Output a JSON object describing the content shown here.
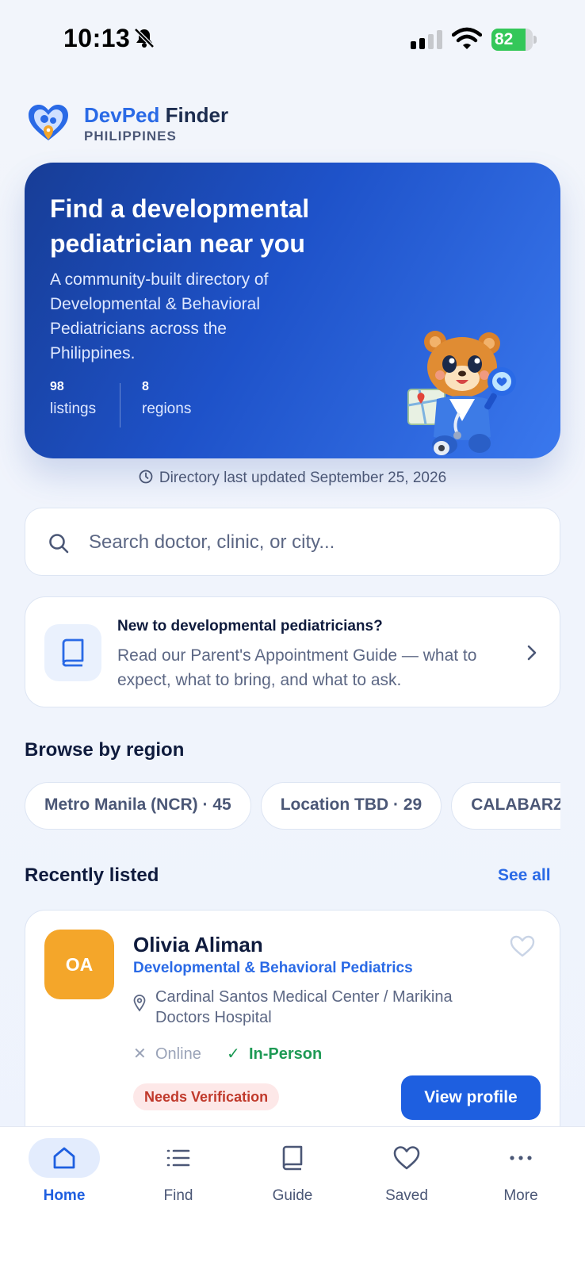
{
  "status_bar": {
    "time": "10:13",
    "battery": "82",
    "battery_level": 0.82
  },
  "brand": {
    "name_part1": "DevPed",
    "name_part2": "Finder",
    "country": "PHILIPPINES"
  },
  "hero": {
    "title": "Find a developmental pediatrician near you",
    "description": "A community-built directory of Developmental & Behavioral Pediatricians across the Philippines.",
    "stats": [
      {
        "value": "98",
        "label": "listings"
      },
      {
        "value": "8",
        "label": "regions"
      }
    ]
  },
  "updated_text": "Directory last updated September 25, 2026",
  "search": {
    "placeholder": "Search doctor, clinic, or city..."
  },
  "guide_card": {
    "title": "New to developmental pediatricians?",
    "text": "Read our Parent's Appointment Guide — what to expect, what to bring, and what to ask."
  },
  "regions": {
    "title": "Browse by region",
    "chips": [
      "Metro Manila (NCR) · 45",
      "Location TBD · 29",
      "CALABARZON"
    ]
  },
  "recent": {
    "title": "Recently listed",
    "see_all": "See all",
    "listing": {
      "initials": "OA",
      "name": "Olivia Aliman",
      "specialty": "Developmental & Behavioral Pediatrics",
      "location": "Cardinal Santos Medical Center / Marikina Doctors Hospital",
      "online_mark": "✕",
      "online_label": "Online",
      "inperson_mark": "✓",
      "inperson_label": "In-Person",
      "badge": "Needs Verification",
      "button": "View profile"
    }
  },
  "nav": {
    "items": [
      {
        "label": "Home",
        "icon": "home-icon"
      },
      {
        "label": "Find",
        "icon": "list-icon"
      },
      {
        "label": "Guide",
        "icon": "book-icon"
      },
      {
        "label": "Saved",
        "icon": "heart-icon"
      },
      {
        "label": "More",
        "icon": "more-icon"
      }
    ]
  },
  "colors": {
    "accent": "#2a6ae6",
    "button": "#1e5fe0",
    "avatar": "#f4a62a",
    "success": "#1e9a55",
    "badge_text": "#c0392b"
  }
}
